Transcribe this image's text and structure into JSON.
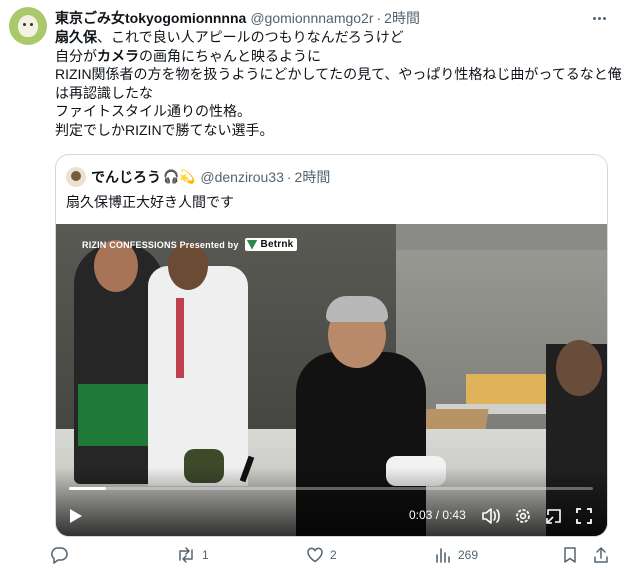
{
  "post": {
    "display_name": "東京ごみ女tokyogomionnnna",
    "handle": "@gomionnnamgo2r",
    "separator": "·",
    "time": "2時間",
    "text": {
      "line1_bold": "扇久保",
      "line1_rest": "、これで良い人アピールのつもりなんだろうけど",
      "line2_a": "自分が",
      "line2_bold": "カメラ",
      "line2_rest": "の画角にちゃんと映るように",
      "line3": "RIZIN関係者の方を物を扱うようにどかしてたの見て、やっぱり性格ねじ曲がってるなと俺",
      "line4": "は再認識したな",
      "line5": "ファイトスタイル通りの性格。",
      "line6": "判定でしかRIZINで勝てない選手。"
    }
  },
  "quote": {
    "display_name": "でんじろう",
    "emoji": "🎧💫",
    "handle": "@denzirou33",
    "separator": "·",
    "time": "2時間",
    "text": "扇久保博正大好き人間です"
  },
  "video": {
    "overlay_title": "RIZIN CONFESSIONS Presented by",
    "brand": "Betrnk",
    "current_time": "0:03",
    "time_sep": "/",
    "duration": "0:43",
    "progress": 0.07
  },
  "actions": {
    "reply": {
      "icon": "reply-icon",
      "count": ""
    },
    "repost": {
      "icon": "repost-icon",
      "count": "1"
    },
    "like": {
      "icon": "heart-icon",
      "count": "2"
    },
    "views": {
      "icon": "views-icon",
      "count": "269"
    },
    "bookmark": {
      "icon": "bookmark-icon"
    },
    "share": {
      "icon": "share-icon"
    }
  },
  "colors": {
    "secondary_text": "#536471",
    "border": "#cfd9de",
    "avatar_green": "#a9c96a"
  }
}
